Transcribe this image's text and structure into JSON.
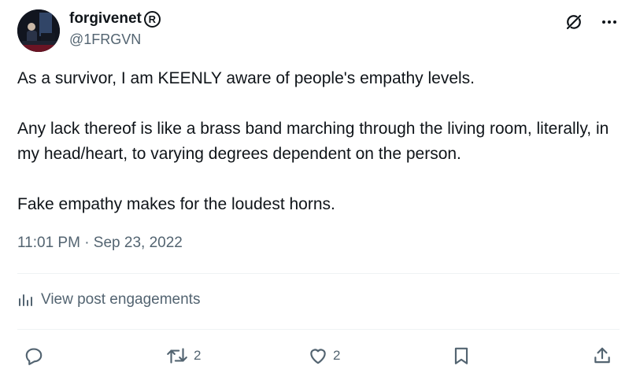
{
  "author": {
    "display_name": "forgivenet",
    "badge_symbol": "R",
    "handle": "@1FRGVN"
  },
  "post": {
    "paragraphs": [
      "As a survivor, I am KEENLY aware of people's empathy levels.",
      "Any lack thereof is like a brass band marching through the living room, literally, in my head/heart, to varying degrees dependent on the person.",
      "Fake empathy makes for the loudest horns."
    ],
    "timestamp": "11:01 PM · Sep 23, 2022"
  },
  "engagements": {
    "label": "View post engagements",
    "icon": "bar-chart-icon"
  },
  "actions": {
    "reply": {
      "icon": "reply-icon",
      "count": ""
    },
    "repost": {
      "icon": "repost-icon",
      "count": "2"
    },
    "like": {
      "icon": "heart-icon",
      "count": "2"
    },
    "bookmark": {
      "icon": "bookmark-icon",
      "count": ""
    },
    "share": {
      "icon": "share-icon",
      "count": ""
    }
  },
  "top_icons": [
    "grok-icon",
    "more-icon"
  ],
  "colors": {
    "text": "#0f1419",
    "secondary": "#536471",
    "divider": "#eff3f4"
  }
}
